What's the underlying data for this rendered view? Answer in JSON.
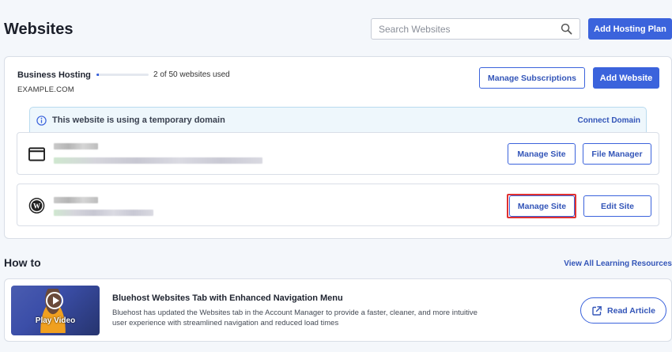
{
  "header": {
    "title": "Websites",
    "search_placeholder": "Search Websites",
    "add_hosting_label": "Add Hosting Plan"
  },
  "hosting": {
    "plan_name": "Business Hosting",
    "usage_text": "2 of 50 websites used",
    "usage_fraction": 0.04,
    "domain": "EXAMPLE.COM",
    "manage_subscriptions_label": "Manage Subscriptions",
    "add_website_label": "Add Website"
  },
  "temp_domain": {
    "message": "This website is using a temporary domain",
    "connect_label": "Connect Domain"
  },
  "sites": [
    {
      "icon": "browser-window-icon",
      "primary_label": "Manage Site",
      "secondary_label": "File Manager"
    },
    {
      "icon": "wordpress-icon",
      "primary_label": "Manage Site",
      "secondary_label": "Edit Site",
      "highlighted": true
    }
  ],
  "howto": {
    "title": "How to",
    "view_all_label": "View All Learning Resources",
    "article": {
      "video_label": "Play Video",
      "title": "Bluehost Websites Tab with Enhanced Navigation Menu",
      "description": "Bluehost has updated the Websites tab in the Account Manager to provide a faster, cleaner, and more intuitive user experience with streamlined navigation and reduced load times",
      "read_label": "Read Article"
    }
  },
  "colors": {
    "primary": "#3b63dc",
    "highlight": "#e03131",
    "banner_bg": "#eef7fc"
  }
}
